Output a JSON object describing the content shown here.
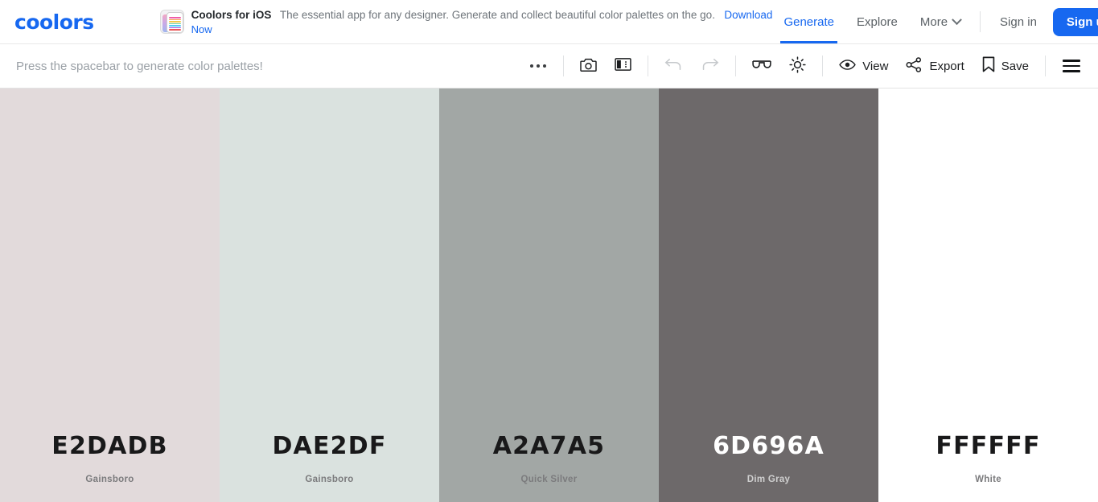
{
  "header": {
    "logo": "coolors",
    "promo": {
      "icon": "ios-app-icon",
      "title": "Coolors for iOS",
      "description": "The essential app for any designer. Generate and collect beautiful color palettes on the go.",
      "download_label": "Download",
      "now_label": "Now",
      "stripe_colors": [
        "#ef5da8",
        "#f2994a",
        "#f2c94c",
        "#6fcf97",
        "#56ccf2",
        "#9b51e0",
        "#eb5757"
      ]
    },
    "nav": [
      {
        "label": "Generate",
        "active": true
      },
      {
        "label": "Explore",
        "active": false
      },
      {
        "label": "More",
        "active": false,
        "has_chevron": true
      }
    ],
    "sign_in_label": "Sign in",
    "sign_up_label": "Sign up",
    "accent_color": "#1768f0"
  },
  "toolbar": {
    "hint": "Press the spacebar to generate color palettes!",
    "more_options_icon": "ellipsis-icon",
    "camera_label": "",
    "camera_icon": "camera-icon",
    "layout_icon": "layout-panel-icon",
    "undo_icon": "undo-arrow-icon",
    "redo_icon": "redo-arrow-icon",
    "glasses_icon": "glasses-icon",
    "brightness_icon": "brightness-sun-icon",
    "view_label": "View",
    "view_icon": "eye-icon",
    "export_label": "Export",
    "export_icon": "share-icon",
    "save_label": "Save",
    "save_icon": "bookmark-icon",
    "menu_icon": "hamburger-menu-icon",
    "undo_disabled": true,
    "redo_disabled": true
  },
  "palette": {
    "swatches": [
      {
        "hex": "E2DADB",
        "css": "#E2DADB",
        "name": "Gainsboro",
        "tone": "light"
      },
      {
        "hex": "DAE2DF",
        "css": "#DAE2DF",
        "name": "Gainsboro",
        "tone": "light"
      },
      {
        "hex": "A2A7A5",
        "css": "#A2A7A5",
        "name": "Quick Silver",
        "tone": "light"
      },
      {
        "hex": "6D696A",
        "css": "#6D696A",
        "name": "Dim Gray",
        "tone": "dark"
      },
      {
        "hex": "FFFFFF",
        "css": "#FFFFFF",
        "name": "White",
        "tone": "light"
      }
    ]
  }
}
